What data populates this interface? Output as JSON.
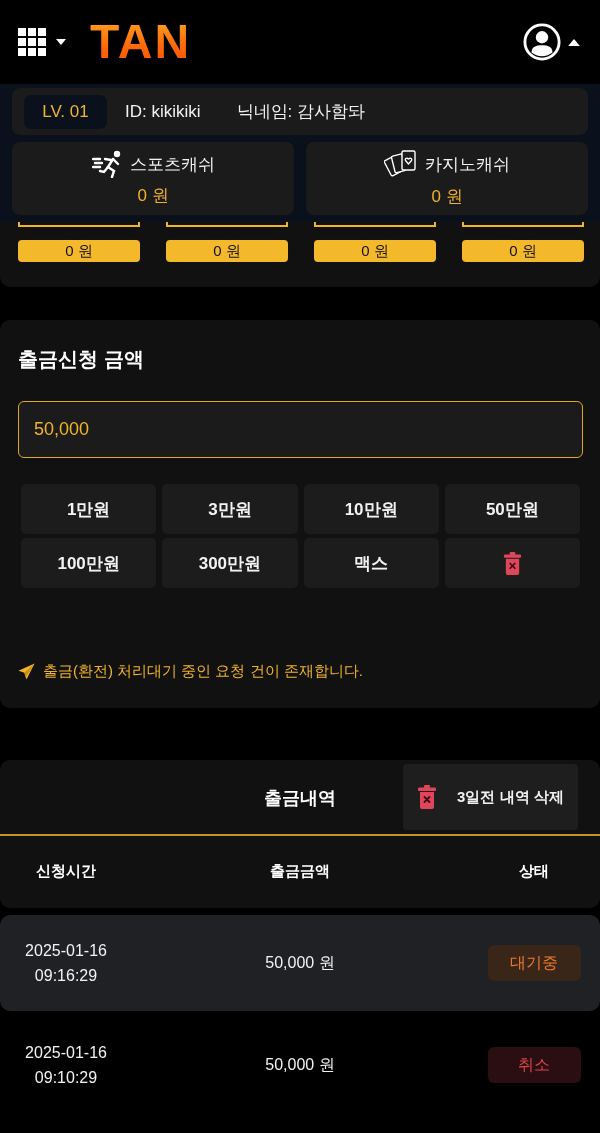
{
  "header": {
    "logo": "TAN"
  },
  "user": {
    "level": "LV. 01",
    "id": "ID: kikikiki",
    "nickname": "닉네임: 감사함돠"
  },
  "cash": [
    {
      "kind": "sports",
      "label": "스포츠캐쉬",
      "amount": "0 원"
    },
    {
      "kind": "casino",
      "label": "카지노캐쉬",
      "amount": "0 원"
    }
  ],
  "wallets": [
    {
      "amount": "0 원"
    },
    {
      "amount": "0 원"
    },
    {
      "amount": "0 원"
    },
    {
      "amount": "0 원"
    }
  ],
  "withdraw": {
    "title": "출금신청 금액",
    "input": {
      "value": "50,000"
    },
    "amount_buttons": [
      {
        "kind": "text",
        "label": "1만원"
      },
      {
        "kind": "text",
        "label": "3만원"
      },
      {
        "kind": "text",
        "label": "10만원"
      },
      {
        "kind": "text",
        "label": "50만원"
      },
      {
        "kind": "text",
        "label": "100만원"
      },
      {
        "kind": "text",
        "label": "300만원"
      },
      {
        "kind": "text",
        "label": "맥스"
      },
      {
        "kind": "clear"
      }
    ],
    "notice": "출금(환전) 처리대기 중인 요청 건이 존재합니다."
  },
  "history": {
    "title": "출금내역",
    "delete_button": "3일전 내역 삭제",
    "columns": [
      "신청시간",
      "출금금액",
      "상태"
    ],
    "rows": [
      {
        "highlighted": true,
        "date": "2025-01-16",
        "time": "09:16:29",
        "amount": "50,000 원",
        "status": {
          "kind": "pending",
          "label": "대기중"
        }
      },
      {
        "highlighted": false,
        "date": "2025-01-16",
        "time": "09:10:29",
        "amount": "50,000 원",
        "status": {
          "kind": "cancelled",
          "label": "취소"
        }
      }
    ]
  }
}
